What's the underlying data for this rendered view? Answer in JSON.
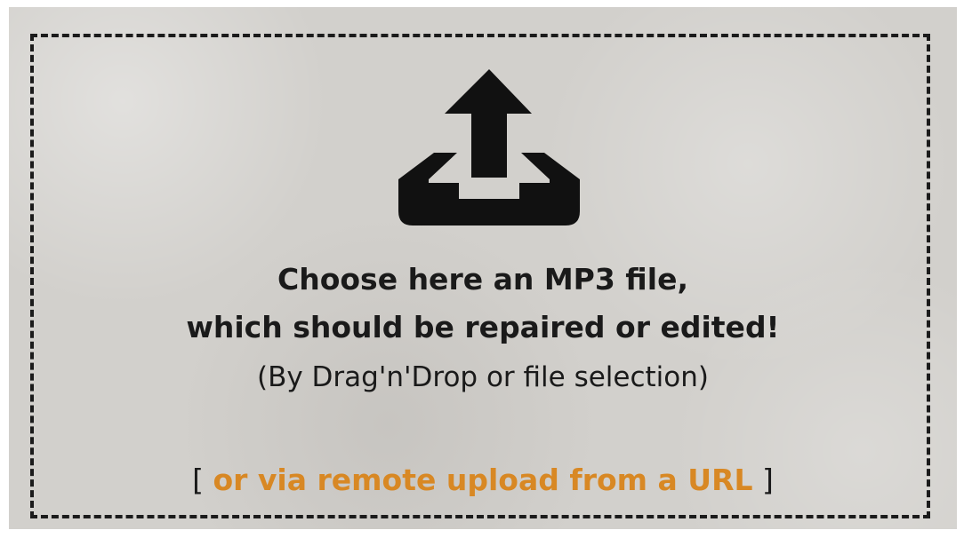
{
  "dropzone": {
    "title_line1": "Choose here an MP3 file,",
    "title_line2": "which should be repaired or edited!",
    "subtitle": "(By Drag'n'Drop or file selection)",
    "bracket_open": "[ ",
    "remote_link": "or via remote upload from a URL",
    "bracket_close": " ]",
    "icon": "upload-tray-icon"
  },
  "colors": {
    "background": "#d2d0cc",
    "text": "#1a1a1a",
    "accent": "#d88824"
  }
}
